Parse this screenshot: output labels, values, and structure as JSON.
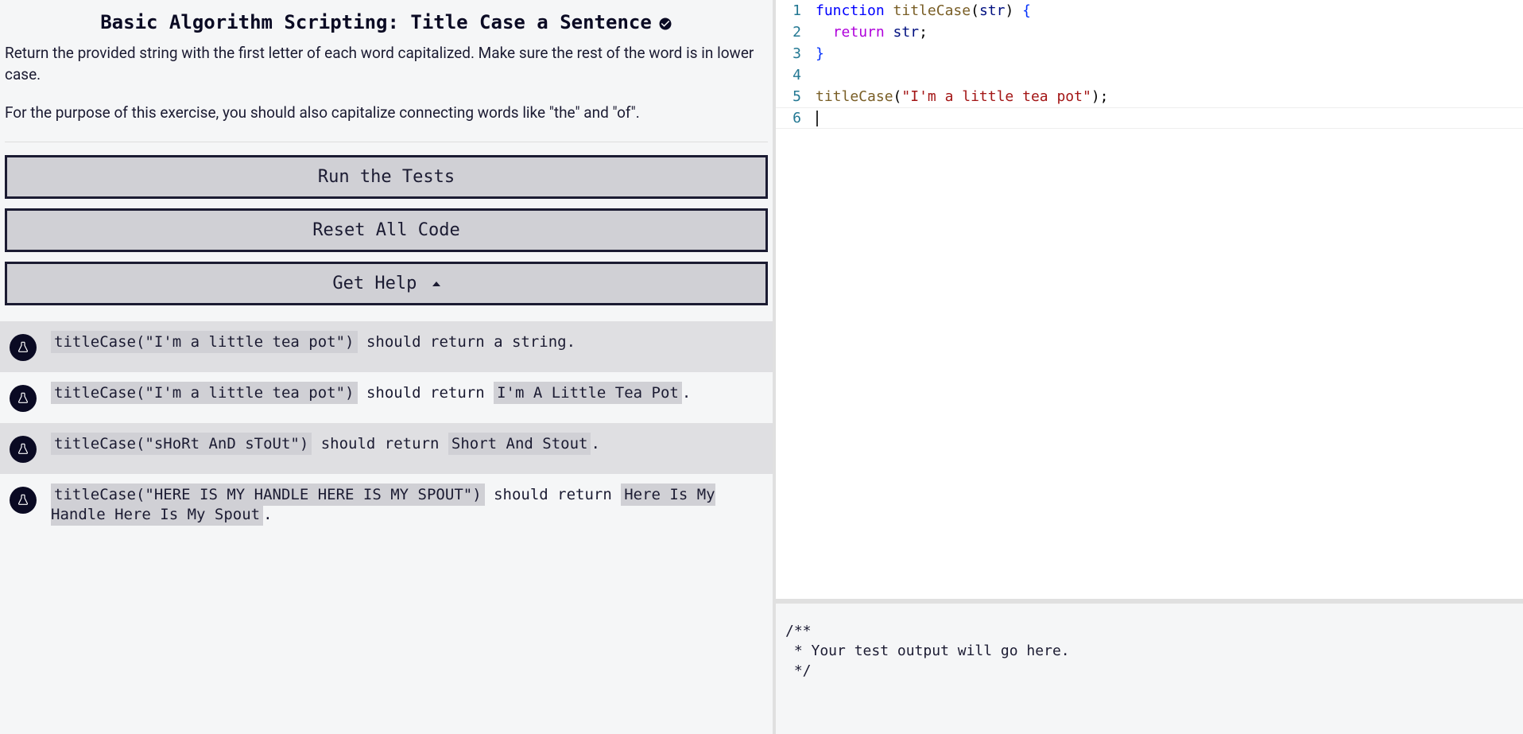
{
  "title": "Basic Algorithm Scripting: Title Case a Sentence",
  "description": {
    "p1": "Return the provided string with the first letter of each word capitalized. Make sure the rest of the word is in lower case.",
    "p2": "For the purpose of this exercise, you should also capitalize connecting words like \"the\" and \"of\"."
  },
  "buttons": {
    "run": "Run the Tests",
    "reset": "Reset All Code",
    "help": "Get Help"
  },
  "tests": [
    {
      "call": "titleCase(\"I'm a little tea pot\")",
      "mid": " should return a string.",
      "expect": ""
    },
    {
      "call": "titleCase(\"I'm a little tea pot\")",
      "mid": " should return ",
      "expect": "I'm A Little Tea Pot"
    },
    {
      "call": "titleCase(\"sHoRt AnD sToUt\")",
      "mid": " should return ",
      "expect": "Short And Stout"
    },
    {
      "call": "titleCase(\"HERE IS MY HANDLE HERE IS MY SPOUT\")",
      "mid": " should return ",
      "expect": "Here Is My Handle Here Is My Spout"
    }
  ],
  "editor": {
    "lines": [
      {
        "n": "1",
        "tokens": [
          [
            "kw",
            "function "
          ],
          [
            "fn",
            "titleCase"
          ],
          [
            "pn",
            "("
          ],
          [
            "id",
            "str"
          ],
          [
            "pn",
            ") "
          ],
          [
            "br",
            "{"
          ]
        ]
      },
      {
        "n": "2",
        "tokens": [
          [
            "pn",
            "  "
          ],
          [
            "ret",
            "return "
          ],
          [
            "id",
            "str"
          ],
          [
            "pn",
            ";"
          ]
        ]
      },
      {
        "n": "3",
        "tokens": [
          [
            "br",
            "}"
          ]
        ]
      },
      {
        "n": "4",
        "tokens": []
      },
      {
        "n": "5",
        "tokens": [
          [
            "fn",
            "titleCase"
          ],
          [
            "pn",
            "("
          ],
          [
            "str",
            "\"I'm a little tea pot\""
          ],
          [
            "pn",
            ");"
          ]
        ]
      },
      {
        "n": "6",
        "tokens": [],
        "cursor": true
      }
    ]
  },
  "output": "/**\n * Your test output will go here.\n */"
}
